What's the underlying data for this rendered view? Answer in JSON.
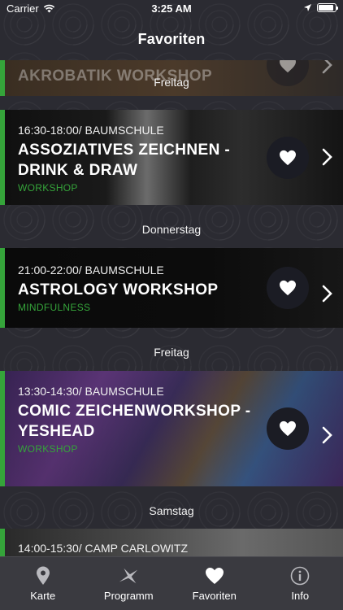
{
  "status_bar": {
    "carrier": "Carrier",
    "time": "3:25 AM"
  },
  "nav": {
    "title": "Favoriten"
  },
  "top_partial": {
    "title": "AKROBATIK WORKSHOP"
  },
  "sections": [
    {
      "day": "Freitag",
      "events": [
        {
          "time": "16:30-18:00/ BAUMSCHULE",
          "title": "ASSOZIATIVES ZEICHNEN - DRINK & DRAW",
          "category": "WORKSHOP"
        }
      ]
    },
    {
      "day": "Donnerstag",
      "events": [
        {
          "time": "21:00-22:00/ BAUMSCHULE",
          "title": "ASTROLOGY WORKSHOP",
          "category": "MINDFULNESS"
        }
      ]
    },
    {
      "day": "Freitag",
      "events": [
        {
          "time": "13:30-14:30/ BAUMSCHULE",
          "title": "COMIC ZEICHENWORKSHOP - YESHEAD",
          "category": "WORKSHOP"
        }
      ]
    },
    {
      "day": "Samstag",
      "events": [
        {
          "time": "14:00-15:30/ CAMP CARLOWITZ",
          "title": "",
          "category": ""
        }
      ]
    }
  ],
  "tabs": [
    {
      "label": "Karte",
      "icon": "map-pin-icon"
    },
    {
      "label": "Programm",
      "icon": "swallow-icon"
    },
    {
      "label": "Favoriten",
      "icon": "heart-icon"
    },
    {
      "label": "Info",
      "icon": "info-icon"
    }
  ],
  "colors": {
    "accent_green": "#35a43a",
    "background": "#2b2b32",
    "tab_bar": "#3a3a40",
    "fav_button": "#1b1c24"
  }
}
